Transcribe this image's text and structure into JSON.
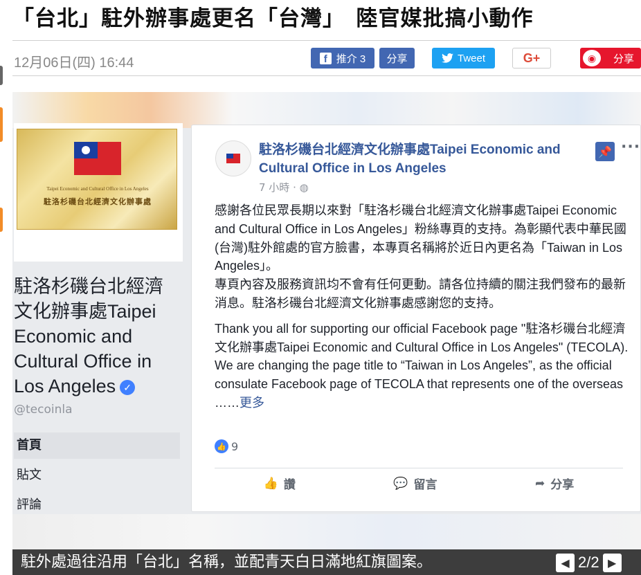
{
  "article": {
    "headline": "「台北」駐外辦事處更名「台灣」　陸官媒批搞小動作",
    "date": "12月06日(四) 16:44"
  },
  "share": {
    "fb_like_label": "推介 3",
    "fb_share_label": "分享",
    "twitter_label": "Tweet",
    "gplus_label": "G+",
    "weibo_label": "分享"
  },
  "photo": {
    "cover_en": "Taipei Economic and Cultural Office in Los Angeles",
    "cover_zh": "駐洛杉磯台北經濟文化辦事處",
    "page_name": "駐洛杉磯台北經濟文化辦事處Taipei Economic and Cultural Office in Los Angeles",
    "handle": "@tecoinla",
    "nav": [
      "首頁",
      "貼文",
      "評論"
    ],
    "post": {
      "author": "駐洛杉磯台北經濟文化辦事處Taipei Economic and Cultural Office in Los Angeles",
      "time": "7 小時 · ",
      "para1": "感謝各位民眾長期以來對「駐洛杉磯台北經濟文化辦事處Taipei Economic and Cultural Office in Los Angeles」粉絲專頁的支持。為彰顯代表中華民國(台灣)駐外館處的官方臉書，本專頁名稱將於近日內更名為「Taiwan in Los Angeles」。",
      "para2": "專頁內容及服務資訊均不會有任何更動。請各位持續的關注我們發布的最新消息。駐洛杉磯台北經濟文化辦事處感謝您的支持。",
      "para3": "Thank you all for supporting our official Facebook page \"駐洛杉磯台北經濟文化辦事處Taipei Economic and Cultural Office in Los Angeles\" (TECOLA).",
      "para4": "We are changing the page title to “Taiwan in Los Angeles”, as the official consulate Facebook page of TECOLA that represents one of the overseas ……",
      "more_link": "更多",
      "like_count": "9",
      "actions": [
        "讚",
        "留言",
        "分享"
      ]
    }
  },
  "caption": "駐外處過往沿用「台北」名稱，並配青天白日滿地紅旗圖案。",
  "pager": "2/2",
  "colors": {
    "facebook": "#4267b2",
    "twitter": "#1da1f2",
    "weibo": "#e6162d",
    "link": "#365899"
  }
}
